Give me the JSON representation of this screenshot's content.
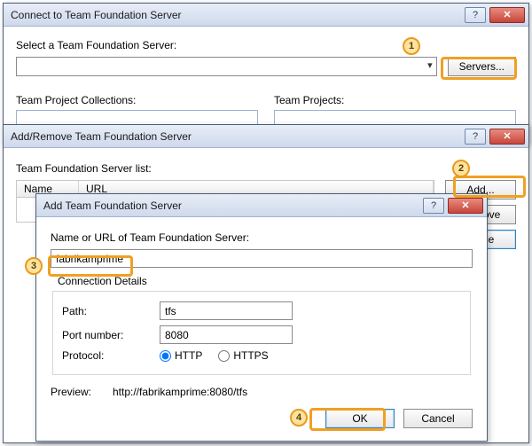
{
  "callouts": {
    "c1": "1",
    "c2": "2",
    "c3": "3",
    "c4": "4"
  },
  "d1": {
    "title": "Connect to Team Foundation Server",
    "select_label": "Select a Team Foundation Server:",
    "servers_btn": "Servers...",
    "collections_label": "Team Project Collections:",
    "projects_label": "Team Projects:"
  },
  "d2": {
    "title": "Add/Remove Team Foundation Server",
    "list_label": "Team Foundation Server list:",
    "col_name": "Name",
    "col_url": "URL",
    "add_btn": "Add...",
    "remove_btn": "Remove",
    "close_btn": "Close"
  },
  "d3": {
    "title": "Add Team Foundation Server",
    "name_label": "Name or URL of Team Foundation Server:",
    "name_value": "fabrikamprime",
    "details_legend": "Connection Details",
    "path_label": "Path:",
    "path_value": "tfs",
    "port_label": "Port number:",
    "port_value": "8080",
    "protocol_label": "Protocol:",
    "http": "HTTP",
    "https": "HTTPS",
    "preview_label": "Preview:",
    "preview_value": "http://fabrikamprime:8080/tfs",
    "ok_btn": "OK",
    "cancel_btn": "Cancel"
  },
  "win": {
    "help": "?",
    "close": "✕"
  }
}
